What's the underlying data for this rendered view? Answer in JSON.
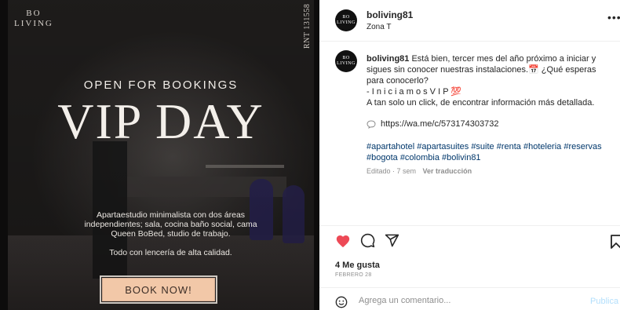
{
  "post_image": {
    "logo_line1": "BO",
    "logo_line2": "LIVING",
    "registration": "RNT 131558",
    "headline": "OPEN FOR BOOKINGS",
    "title": "VIP DAY",
    "description": "Apartaestudio minimalista con dos áreas independientes; sala, cocina baño social, cama Queen BoBed, studio de trabajo.",
    "description2": "Todo con lencería de alta calidad.",
    "cta_label": "BOOK NOW!"
  },
  "header": {
    "avatar_text": "BO LIVING",
    "username": "boliving81",
    "location": "Zona T",
    "more_icon": "ellipsis-icon"
  },
  "caption": {
    "username": "boliving81",
    "text": "Está bien, tercer mes del año próximo a iniciar y sigues sin conocer nuestras instalaciones.📅 ¿Qué esperas para conocerlo?",
    "line2": "- I n i c i a m o s V I P 💯",
    "line3": "A tan solo un click, de encontrar información más detallada.",
    "link": "https://wa.me/c/573174303732",
    "hashtags": "#apartahotel #apartasuites #suite #renta #hoteleria #reservas #bogota #colombia #bolivin81",
    "edited": "Editado · 7 sem",
    "translate": "Ver traducción"
  },
  "actions": {
    "like_icon": "heart-icon",
    "comment_icon": "comment-icon",
    "share_icon": "send-icon",
    "save_icon": "bookmark-icon",
    "liked_color": "#ed4956"
  },
  "stats": {
    "likes": "4 Me gusta",
    "date": "FEBRERO 28"
  },
  "comment_box": {
    "placeholder": "Agrega un comentario...",
    "publish_label": "Publica"
  }
}
